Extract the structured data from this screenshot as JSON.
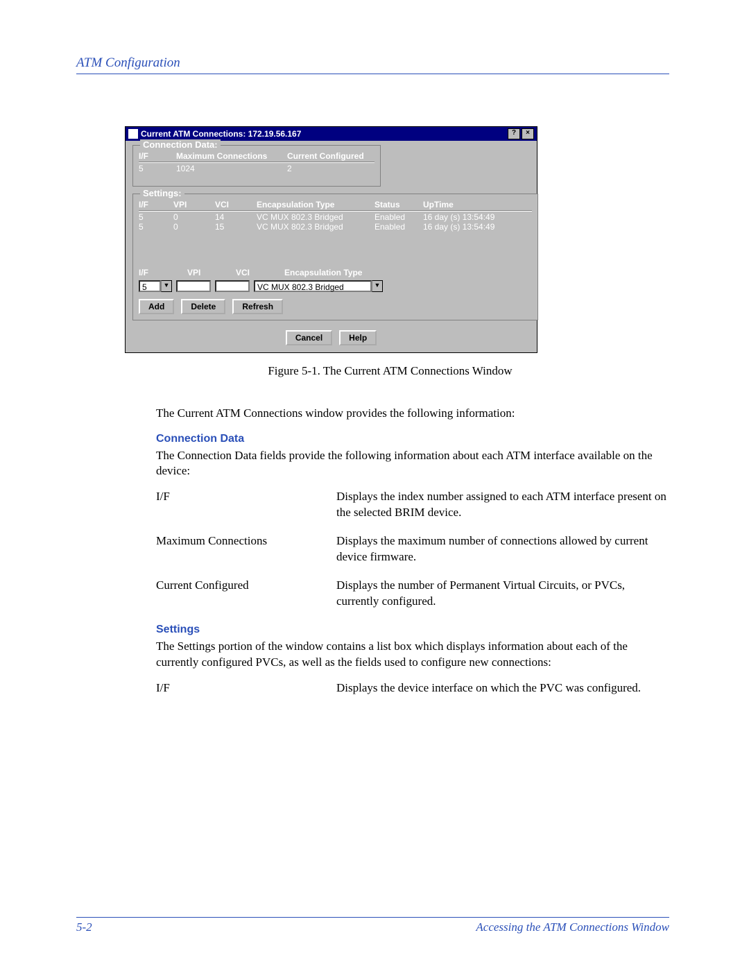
{
  "header": {
    "section_title": "ATM Configuration"
  },
  "window": {
    "title": "Current ATM Connections: 172.19.56.167",
    "groups": {
      "conn_data": {
        "legend": "Connection Data:",
        "headers": {
          "if": "I/F",
          "max": "Maximum Connections",
          "cur": "Current Configured"
        },
        "row": {
          "if": "5",
          "max": "1024",
          "cur": "2"
        }
      },
      "settings": {
        "legend": "Settings:",
        "headers": {
          "if": "I/F",
          "vpi": "VPI",
          "vci": "VCI",
          "enc": "Encapsulation Type",
          "status": "Status",
          "uptime": "UpTime"
        },
        "rows": [
          {
            "if": "5",
            "vpi": "0",
            "vci": "14",
            "enc": "VC MUX 802.3 Bridged",
            "status": "Enabled",
            "uptime": "16 day (s) 13:54:49"
          },
          {
            "if": "5",
            "vpi": "0",
            "vci": "15",
            "enc": "VC MUX 802.3 Bridged",
            "status": "Enabled",
            "uptime": "16 day (s) 13:54:49"
          }
        ],
        "form_labels": {
          "if": "I/F",
          "vpi": "VPI",
          "vci": "VCI",
          "enc": "Encapsulation Type"
        },
        "form_values": {
          "if": "5",
          "vpi": "",
          "vci": "",
          "enc": "VC MUX 802.3 Bridged"
        },
        "buttons": {
          "add": "Add",
          "delete": "Delete",
          "refresh": "Refresh"
        }
      }
    },
    "bottom_buttons": {
      "cancel": "Cancel",
      "help": "Help"
    }
  },
  "figure_caption": "Figure 5-1. The Current ATM Connections Window",
  "prose": {
    "intro": "The Current ATM Connections window provides the following information:",
    "conn_heading": "Connection Data",
    "conn_desc": "The Connection Data fields provide the following information about each ATM interface available on the device:",
    "defs1": [
      {
        "term": "I/F",
        "def": "Displays the index number assigned to each ATM interface present on the selected BRIM device."
      },
      {
        "term": "Maximum Connections",
        "def": "Displays the maximum number of connections allowed by current device firmware."
      },
      {
        "term": "Current Configured",
        "def": "Displays the number of Permanent Virtual Circuits, or PVCs, currently configured."
      }
    ],
    "settings_heading": "Settings",
    "settings_desc": "The Settings portion of the window contains a list box which displays information about each of the currently configured PVCs, as well as the fields used to configure new connections:",
    "defs2": [
      {
        "term": "I/F",
        "def": "Displays the device interface on which the PVC was configured."
      }
    ]
  },
  "footer": {
    "page": "5-2",
    "right": "Accessing the ATM Connections Window"
  }
}
